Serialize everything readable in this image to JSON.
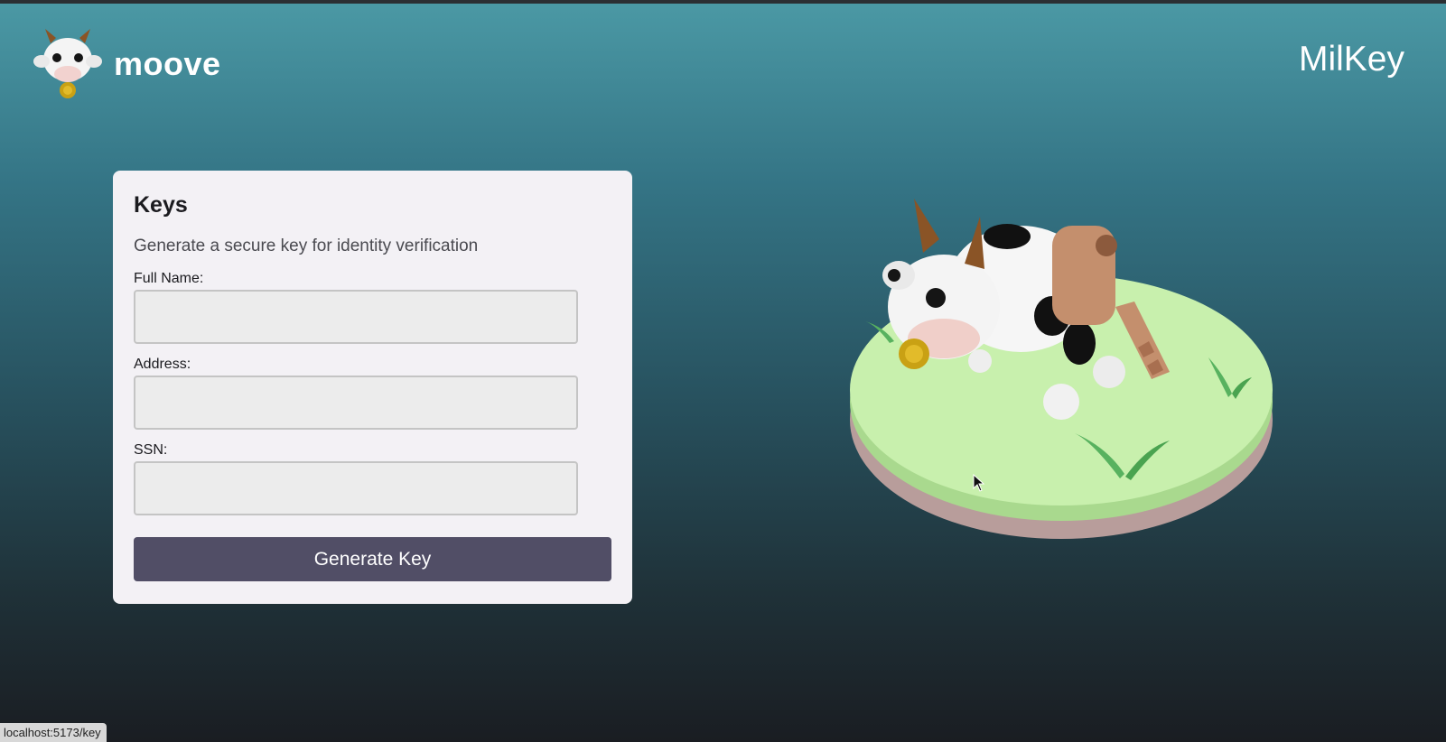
{
  "brand": {
    "name": "moove",
    "logo_icon": "cow-head-icon"
  },
  "app_title": "MilKey",
  "form": {
    "title": "Keys",
    "subtitle": "Generate a secure key for identity verification",
    "fields": [
      {
        "label": "Full Name:",
        "value": "",
        "placeholder": ""
      },
      {
        "label": "Address:",
        "value": "",
        "placeholder": ""
      },
      {
        "label": "SSN:",
        "value": "",
        "placeholder": ""
      }
    ],
    "submit_label": "Generate Key"
  },
  "illustration": {
    "icon": "cow-with-key-illustration"
  },
  "status_bar": {
    "url": "localhost:5173/key"
  },
  "colors": {
    "button": "#514e66",
    "card": "#f3f1f5",
    "bg_top": "#4b99a5",
    "bg_bottom": "#1a1d22"
  }
}
